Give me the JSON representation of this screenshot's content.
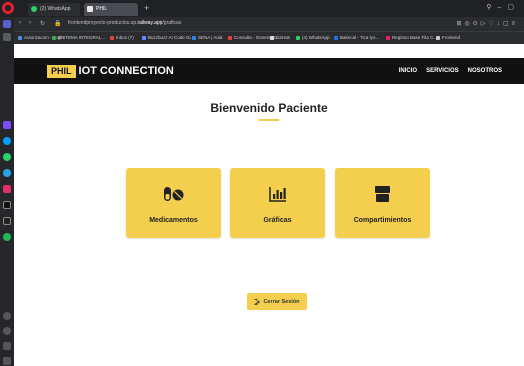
{
  "browser": {
    "tabs": [
      {
        "label": "(2) WhatsApp"
      },
      {
        "label": "PHIL"
      }
    ],
    "new_tab": "+",
    "url_prefix": "frontendproyecto-productos.up.",
    "url_highlight": "railway.app",
    "url_suffix": "/graficas",
    "bookmarks": [
      {
        "label": "Autorizacion - Login",
        "color": "#4a90e2"
      },
      {
        "label": "SISTEMA INTEGRAL...",
        "color": "#3aa757"
      },
      {
        "label": "Inbox (7)",
        "color": "#ea4335"
      },
      {
        "label": "Buzzbuzz AI Code Gi...",
        "color": "#5f8dff"
      },
      {
        "label": "SENA | Aula",
        "color": "#2f80ed"
      },
      {
        "label": "Consulta - Genera GL...",
        "color": "#ea4335"
      },
      {
        "label": "GitHub",
        "color": "#dddddd"
      },
      {
        "label": "(4) WhatsApp",
        "color": "#25d366"
      },
      {
        "label": "Bakecal - Tica tyo...",
        "color": "#1a73e8"
      },
      {
        "label": "Registro Base Fila C...",
        "color": "#e91e63"
      },
      {
        "label": "Frontend",
        "color": "#cccccc"
      }
    ]
  },
  "header": {
    "brand_badge": "PHIL",
    "brand_text": "IOT CONNECTION",
    "nav": [
      "INICIO",
      "SERVICIOS",
      "NOSOTROS"
    ]
  },
  "main": {
    "welcome": "Bienvenido Paciente",
    "cards": [
      {
        "label": "Medicamentos",
        "icon": "pills-icon"
      },
      {
        "label": "Gráficas",
        "icon": "bar-chart-icon"
      },
      {
        "label": "Compartimientos",
        "icon": "box-icon"
      }
    ],
    "logout_label": "Cerrar Sesión"
  },
  "colors": {
    "accent": "#f4cf4e",
    "header_bg": "#111111"
  }
}
